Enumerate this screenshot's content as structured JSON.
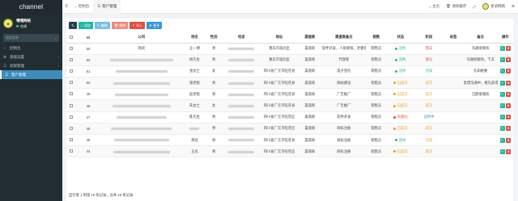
{
  "sidebar": {
    "logo": "channel",
    "user_name": "嘿嘿网络",
    "user_status": "在线",
    "search_placeholder": "搜索菜单",
    "items": [
      {
        "label": "控制台",
        "icon": "dashboard-icon",
        "glyph": "◔",
        "active": false
      },
      {
        "label": "基础设置",
        "icon": "settings-icon",
        "glyph": "⚙",
        "active": false
      },
      {
        "label": "权限管理",
        "icon": "group-icon",
        "glyph": "☷",
        "active": false
      },
      {
        "label": "客户管理",
        "icon": "list-icon",
        "glyph": "☰",
        "active": true
      }
    ]
  },
  "topbar": {
    "tabs": [
      {
        "label": "控制台",
        "active": false
      },
      {
        "label": "客户管理",
        "active": true
      }
    ],
    "right": {
      "home": "主页",
      "clear_cache": "清除缓存",
      "user": "星语网络"
    }
  },
  "toolbar": {
    "add": "添加",
    "edit": "编辑",
    "delete": "删除",
    "import": "导入",
    "more": "更多"
  },
  "table": {
    "columns": [
      "Id",
      "公司",
      "姓名",
      "性别",
      "电话",
      "地址",
      "渠道商",
      "渠道商备注",
      "销售",
      "状态",
      "阶段",
      "标签",
      "备注",
      "操作"
    ],
    "rows": [
      {
        "id": "55",
        "company": "测试",
        "name": "王一博",
        "gender": "男",
        "address": "重庆市渝北区",
        "channel": "渠道商",
        "channel_note": "软件开发，人很爽快，老婆很支",
        "sales": "销售员",
        "status": "流失",
        "status_color": "#18bc9c",
        "stage": "意向",
        "stage_color": "#e74c3c",
        "tag": "",
        "note": "沟通很愉快"
      },
      {
        "id": "52",
        "company": "",
        "name": "杨先生",
        "gender": "男",
        "address": "重庆市渝北区",
        "channel": "渠道商",
        "channel_note": "代理者",
        "sales": "销售员",
        "status": "流失",
        "status_color": "#18bc9c",
        "stage": "意向",
        "stage_color": "#e74c3c",
        "tag": "",
        "note": "沟通很愉快，下次"
      },
      {
        "id": "51",
        "company": "",
        "name": "张女士",
        "gender": "女",
        "address": "四川省广元市旺苍县",
        "channel": "渠道商",
        "channel_note": "电子签约",
        "sales": "销售员",
        "status": "流失",
        "status_color": "#18bc9c",
        "stage": "洽谈",
        "stage_color": "#18bc9c",
        "tag": "",
        "note": "先如她要"
      },
      {
        "id": "50",
        "company": "",
        "name": "钱老板",
        "gender": "男",
        "address": "四川省广元市旺苍县",
        "channel": "渠道商",
        "channel_note": "网站建设",
        "sales": "销售员",
        "status": "已成交",
        "status_color": "#f39c12",
        "stage": "成交",
        "stage_color": "#f39c12",
        "tag": "",
        "note": "反馈沟通中，要先获得"
      },
      {
        "id": "49",
        "company": "",
        "name": "赵老板",
        "gender": "男",
        "address": "四川省广元市旺苍县",
        "channel": "渠道商",
        "channel_note": "广告推广",
        "sales": "销售员",
        "status": "已成交",
        "status_color": "#f39c12",
        "stage": "成交",
        "stage_color": "#f39c12",
        "tag": "",
        "note": "沉默很愉快"
      },
      {
        "id": "48",
        "company": "",
        "name": "朱女士",
        "gender": "女",
        "address": "四川省广元市旺苍县",
        "channel": "渠道商",
        "channel_note": "广告推广",
        "sales": "销售员",
        "status": "已成交",
        "status_color": "#f39c12",
        "stage": "成交",
        "stage_color": "#f39c12",
        "tag": "",
        "note": ""
      },
      {
        "id": "47",
        "company": "",
        "name": "陈先生",
        "gender": "男",
        "address": "四川省广元市旺苍区",
        "channel": "渠道商",
        "channel_note": "软件开发",
        "sales": "销售员",
        "status": "有意向",
        "status_color": "#e74c3c",
        "stage": "谈判中",
        "stage_color": "#3498db",
        "tag": "",
        "note": ""
      },
      {
        "id": "46",
        "company": "",
        "name": "",
        "gender": "男",
        "address": "四川省广元市旺苍区",
        "channel": "渠道商",
        "channel_note": "商标注册",
        "sales": "销售员",
        "status": "已成交",
        "status_color": "#f39c12",
        "stage": "成交",
        "stage_color": "#f39c12",
        "tag": "",
        "note": ""
      },
      {
        "id": "45",
        "company": "",
        "name": "龚总",
        "gender": "男",
        "address": "四川省广元市旺苍县",
        "channel": "渠道商",
        "channel_note": "商标注册",
        "sales": "销售员",
        "status": "流失",
        "status_color": "#18bc9c",
        "stage": "洽谈",
        "stage_color": "#f39c12",
        "tag": "",
        "note": ""
      },
      {
        "id": "44",
        "company": "",
        "name": "王总",
        "gender": "男",
        "address": "四川省广元市旺苍区",
        "channel": "渠道商",
        "channel_note": "商标注册",
        "sales": "销售员",
        "status": "已成交",
        "status_color": "#f39c12",
        "stage": "成交",
        "stage_color": "#f39c12",
        "tag": "",
        "note": ""
      }
    ]
  },
  "footer": "显示第 1 到第 10 条记录，总共 10 条记录"
}
